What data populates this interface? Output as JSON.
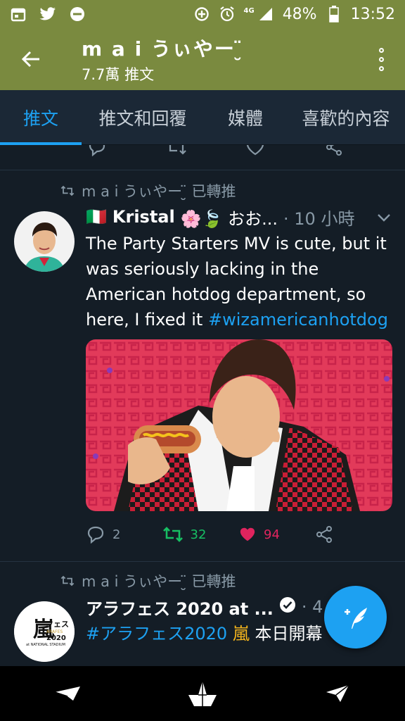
{
  "status_bar": {
    "left_icons": [
      "calendar-icon",
      "twitter-bird-icon",
      "do-not-disturb-icon"
    ],
    "network": "4G",
    "battery": "48%",
    "time": "13:52"
  },
  "app_bar": {
    "title": "m a i うぃやー ̮̈",
    "subtitle": "7.7萬 推文"
  },
  "tabs": [
    {
      "label": "推文"
    },
    {
      "label": "推文和回覆"
    },
    {
      "label": "媒體"
    },
    {
      "label": "喜歡的內容"
    }
  ],
  "tweets": [
    {
      "retweeted_by": "m a i うぃやー ̮̈ 已轉推",
      "flag": "🇮🇹",
      "display_name": "Kristal",
      "name_suffix": "🌸🍃 おお...",
      "time": "· 10 小時",
      "text_lines": [
        "The Party Starters MV is cute, but it",
        "was seriously lacking in the",
        "American hotdog department, so"
      ],
      "text_last": "here, I fixed it",
      "hashtag": "#wizamericanhotdog",
      "replies": "2",
      "retweets": "32",
      "likes": "94"
    },
    {
      "retweeted_by": "m a i うぃやー ̮̈ 已轉推",
      "display_name": "アラフェス 2020 at ...",
      "time": "· 4",
      "hashtag": "#アラフェス2020",
      "text_rest": "本日開幕",
      "avatar_logo": {
        "kanji": "嵐",
        "line1": "フェス",
        "line2": "ARAFES",
        "line3": "2020",
        "line4": "at NATIONAL STADIUM"
      }
    }
  ],
  "colors": {
    "header": "#7a8a3f",
    "accent": "#1da1f2",
    "background": "#141d26",
    "retweet": "#17bf63",
    "like": "#e0245e"
  }
}
